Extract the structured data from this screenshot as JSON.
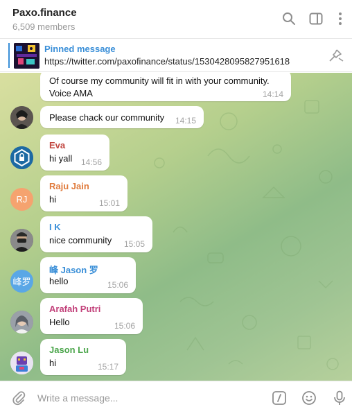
{
  "header": {
    "title": "Paxo.finance",
    "subtitle": "6,509 members",
    "icons": [
      "search-icon",
      "sidebar-toggle-icon",
      "more-vertical-icon"
    ]
  },
  "pinned": {
    "label": "Pinned message",
    "text": "https://twitter.com/paxofinance/status/1530428095827951618",
    "icon": "unpin-icon"
  },
  "messages": [
    {
      "sender": "",
      "lines": [
        "Of course my community will fit in with your community.",
        "Voice AMA"
      ],
      "time": "14:14"
    },
    {
      "sender": "",
      "lines": [
        "Please chack our community"
      ],
      "time": "14:15"
    },
    {
      "sender": "Eva",
      "sender_color": "#c0453e",
      "lines": [
        "hi yall"
      ],
      "time": "14:56"
    },
    {
      "sender": "Raju Jain",
      "sender_color": "#e07b3c",
      "avatar_initials": "RJ",
      "avatar_color": "#f5a36f",
      "lines": [
        "hi"
      ],
      "time": "15:01"
    },
    {
      "sender": "I K",
      "sender_color": "#3a8fd8",
      "lines": [
        "nice community"
      ],
      "time": "15:05"
    },
    {
      "sender": "峰 Jason 罗",
      "sender_color": "#3a8fd8",
      "avatar_initials": "峰罗",
      "avatar_color": "#5aa7e6",
      "lines": [
        "hello"
      ],
      "time": "15:06"
    },
    {
      "sender": "Arafah Putri",
      "sender_color": "#c2417a",
      "lines": [
        "Hello"
      ],
      "time": "15:06"
    },
    {
      "sender": "Jason Lu",
      "sender_color": "#4ca64c",
      "lines": [
        "hi"
      ],
      "time": "15:17"
    }
  ],
  "composer": {
    "placeholder": "Write a message...",
    "icons": [
      "attach-icon",
      "command-icon",
      "emoji-icon",
      "microphone-icon"
    ]
  }
}
